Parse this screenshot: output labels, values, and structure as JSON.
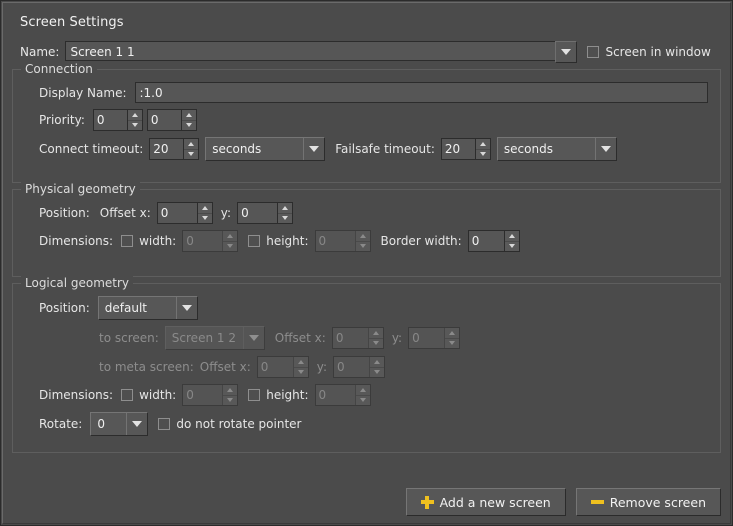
{
  "window": {
    "title": "Screen Settings"
  },
  "name_row": {
    "label": "Name:",
    "value": "Screen 1 1",
    "dropdown_icon": "chevron-down-icon",
    "screen_in_window_label": "Screen in window",
    "screen_in_window_checked": false
  },
  "connection": {
    "title": "Connection",
    "display_name_label": "Display Name:",
    "display_name_value": ":1.0",
    "priority_label": "Priority:",
    "priority_1": "0",
    "priority_2": "0",
    "connect_timeout_label": "Connect timeout:",
    "connect_timeout_value": "20",
    "connect_timeout_unit": "seconds",
    "failsafe_timeout_label": "Failsafe timeout:",
    "failsafe_timeout_value": "20",
    "failsafe_timeout_unit": "seconds"
  },
  "physical_geometry": {
    "title": "Physical geometry",
    "position_label": "Position:",
    "offset_x_label": "Offset x:",
    "offset_x_value": "0",
    "offset_y_label": "y:",
    "offset_y_value": "0",
    "dimensions_label": "Dimensions:",
    "width_label": "width:",
    "width_value": "0",
    "width_checked": false,
    "height_label": "height:",
    "height_value": "0",
    "height_checked": false,
    "border_width_label": "Border width:",
    "border_width_value": "0"
  },
  "logical_geometry": {
    "title": "Logical geometry",
    "position_label": "Position:",
    "position_value": "default",
    "to_screen_label": "to screen:",
    "to_screen_value": "Screen 1 2",
    "to_screen_offset_x_label": "Offset x:",
    "to_screen_offset_x_value": "0",
    "to_screen_offset_y_label": "y:",
    "to_screen_offset_y_value": "0",
    "to_meta_screen_label": "to meta screen:",
    "to_meta_offset_x_label": "Offset x:",
    "to_meta_offset_x_value": "0",
    "to_meta_offset_y_label": "y:",
    "to_meta_offset_y_value": "0",
    "dimensions_label": "Dimensions:",
    "width_label": "width:",
    "width_value": "0",
    "width_checked": false,
    "height_label": "height:",
    "height_value": "0",
    "height_checked": false,
    "rotate_label": "Rotate:",
    "rotate_value": "0",
    "do_not_rotate_pointer_label": "do not rotate pointer",
    "do_not_rotate_pointer_checked": false
  },
  "footer": {
    "add_button_label": "Add a new screen",
    "add_button_icon": "plus-icon",
    "remove_button_label": "Remove screen",
    "remove_button_icon": "minus-icon"
  },
  "colors": {
    "background": "#4b4b4b",
    "field": "#565656",
    "text": "#e8e8e8",
    "disabled_text": "#8a8a8a",
    "accent_icon": "#efc01f"
  }
}
